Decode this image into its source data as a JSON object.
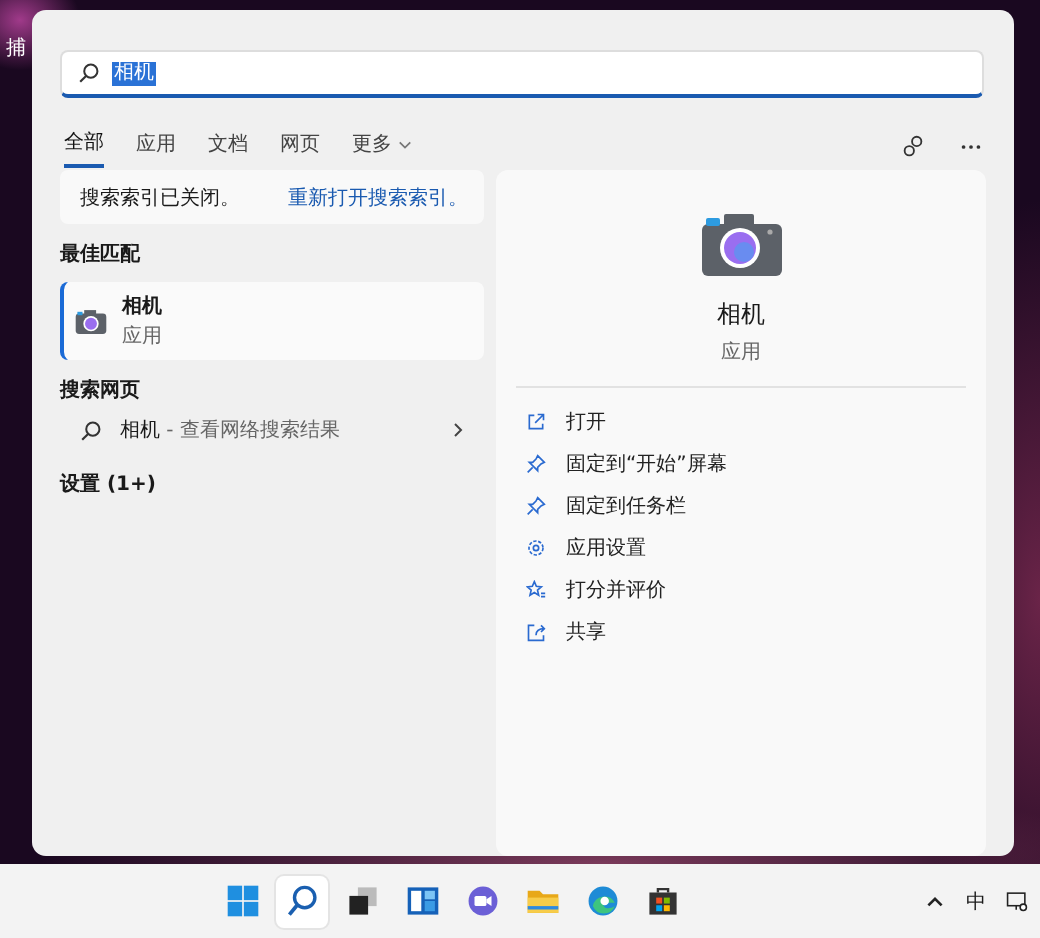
{
  "desktop": {
    "icon_label": "捕"
  },
  "search": {
    "value": "相机"
  },
  "tabs": [
    {
      "label": "全部",
      "selected": true
    },
    {
      "label": "应用",
      "selected": false
    },
    {
      "label": "文档",
      "selected": false
    },
    {
      "label": "网页",
      "selected": false
    },
    {
      "label": "更多",
      "selected": false,
      "kind": "dropdown"
    }
  ],
  "notice": {
    "text": "搜索索引已关闭。",
    "link": "重新打开搜索索引。"
  },
  "best_match": {
    "heading": "最佳匹配",
    "title": "相机",
    "subtitle": "应用",
    "selected": true
  },
  "web_search": {
    "heading": "搜索网页",
    "query": "相机",
    "hint": " - 查看网络搜索结果"
  },
  "settings": {
    "heading": "设置 (1+)"
  },
  "detail": {
    "title": "相机",
    "subtitle": "应用",
    "actions": [
      {
        "kind": "open",
        "label": "打开"
      },
      {
        "kind": "pin",
        "label": "固定到“开始”屏幕"
      },
      {
        "kind": "pin",
        "label": "固定到任务栏"
      },
      {
        "kind": "settings",
        "label": "应用设置"
      },
      {
        "kind": "rate",
        "label": "打分并评价"
      },
      {
        "kind": "share",
        "label": "共享"
      }
    ]
  },
  "taskbar": {
    "items": [
      {
        "kind": "start",
        "selected": false
      },
      {
        "kind": "search",
        "selected": true
      },
      {
        "kind": "taskview",
        "selected": false
      },
      {
        "kind": "widgets",
        "selected": false
      },
      {
        "kind": "chat",
        "selected": false
      },
      {
        "kind": "explorer",
        "selected": false
      },
      {
        "kind": "edge",
        "selected": false
      },
      {
        "kind": "store",
        "selected": false
      }
    ],
    "input_method": "中"
  }
}
